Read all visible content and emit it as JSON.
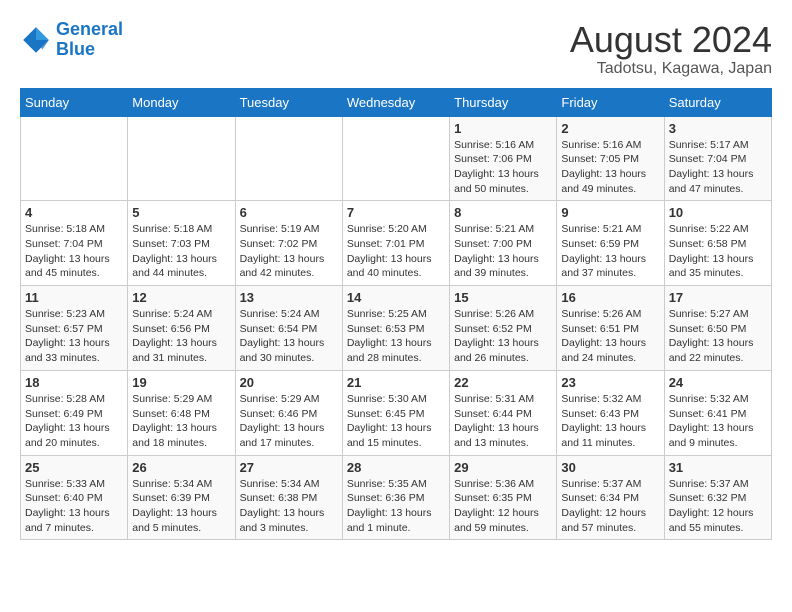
{
  "header": {
    "logo_line1": "General",
    "logo_line2": "Blue",
    "month_year": "August 2024",
    "location": "Tadotsu, Kagawa, Japan"
  },
  "weekdays": [
    "Sunday",
    "Monday",
    "Tuesday",
    "Wednesday",
    "Thursday",
    "Friday",
    "Saturday"
  ],
  "weeks": [
    [
      {
        "day": "",
        "info": ""
      },
      {
        "day": "",
        "info": ""
      },
      {
        "day": "",
        "info": ""
      },
      {
        "day": "",
        "info": ""
      },
      {
        "day": "1",
        "info": "Sunrise: 5:16 AM\nSunset: 7:06 PM\nDaylight: 13 hours\nand 50 minutes."
      },
      {
        "day": "2",
        "info": "Sunrise: 5:16 AM\nSunset: 7:05 PM\nDaylight: 13 hours\nand 49 minutes."
      },
      {
        "day": "3",
        "info": "Sunrise: 5:17 AM\nSunset: 7:04 PM\nDaylight: 13 hours\nand 47 minutes."
      }
    ],
    [
      {
        "day": "4",
        "info": "Sunrise: 5:18 AM\nSunset: 7:04 PM\nDaylight: 13 hours\nand 45 minutes."
      },
      {
        "day": "5",
        "info": "Sunrise: 5:18 AM\nSunset: 7:03 PM\nDaylight: 13 hours\nand 44 minutes."
      },
      {
        "day": "6",
        "info": "Sunrise: 5:19 AM\nSunset: 7:02 PM\nDaylight: 13 hours\nand 42 minutes."
      },
      {
        "day": "7",
        "info": "Sunrise: 5:20 AM\nSunset: 7:01 PM\nDaylight: 13 hours\nand 40 minutes."
      },
      {
        "day": "8",
        "info": "Sunrise: 5:21 AM\nSunset: 7:00 PM\nDaylight: 13 hours\nand 39 minutes."
      },
      {
        "day": "9",
        "info": "Sunrise: 5:21 AM\nSunset: 6:59 PM\nDaylight: 13 hours\nand 37 minutes."
      },
      {
        "day": "10",
        "info": "Sunrise: 5:22 AM\nSunset: 6:58 PM\nDaylight: 13 hours\nand 35 minutes."
      }
    ],
    [
      {
        "day": "11",
        "info": "Sunrise: 5:23 AM\nSunset: 6:57 PM\nDaylight: 13 hours\nand 33 minutes."
      },
      {
        "day": "12",
        "info": "Sunrise: 5:24 AM\nSunset: 6:56 PM\nDaylight: 13 hours\nand 31 minutes."
      },
      {
        "day": "13",
        "info": "Sunrise: 5:24 AM\nSunset: 6:54 PM\nDaylight: 13 hours\nand 30 minutes."
      },
      {
        "day": "14",
        "info": "Sunrise: 5:25 AM\nSunset: 6:53 PM\nDaylight: 13 hours\nand 28 minutes."
      },
      {
        "day": "15",
        "info": "Sunrise: 5:26 AM\nSunset: 6:52 PM\nDaylight: 13 hours\nand 26 minutes."
      },
      {
        "day": "16",
        "info": "Sunrise: 5:26 AM\nSunset: 6:51 PM\nDaylight: 13 hours\nand 24 minutes."
      },
      {
        "day": "17",
        "info": "Sunrise: 5:27 AM\nSunset: 6:50 PM\nDaylight: 13 hours\nand 22 minutes."
      }
    ],
    [
      {
        "day": "18",
        "info": "Sunrise: 5:28 AM\nSunset: 6:49 PM\nDaylight: 13 hours\nand 20 minutes."
      },
      {
        "day": "19",
        "info": "Sunrise: 5:29 AM\nSunset: 6:48 PM\nDaylight: 13 hours\nand 18 minutes."
      },
      {
        "day": "20",
        "info": "Sunrise: 5:29 AM\nSunset: 6:46 PM\nDaylight: 13 hours\nand 17 minutes."
      },
      {
        "day": "21",
        "info": "Sunrise: 5:30 AM\nSunset: 6:45 PM\nDaylight: 13 hours\nand 15 minutes."
      },
      {
        "day": "22",
        "info": "Sunrise: 5:31 AM\nSunset: 6:44 PM\nDaylight: 13 hours\nand 13 minutes."
      },
      {
        "day": "23",
        "info": "Sunrise: 5:32 AM\nSunset: 6:43 PM\nDaylight: 13 hours\nand 11 minutes."
      },
      {
        "day": "24",
        "info": "Sunrise: 5:32 AM\nSunset: 6:41 PM\nDaylight: 13 hours\nand 9 minutes."
      }
    ],
    [
      {
        "day": "25",
        "info": "Sunrise: 5:33 AM\nSunset: 6:40 PM\nDaylight: 13 hours\nand 7 minutes."
      },
      {
        "day": "26",
        "info": "Sunrise: 5:34 AM\nSunset: 6:39 PM\nDaylight: 13 hours\nand 5 minutes."
      },
      {
        "day": "27",
        "info": "Sunrise: 5:34 AM\nSunset: 6:38 PM\nDaylight: 13 hours\nand 3 minutes."
      },
      {
        "day": "28",
        "info": "Sunrise: 5:35 AM\nSunset: 6:36 PM\nDaylight: 13 hours\nand 1 minute."
      },
      {
        "day": "29",
        "info": "Sunrise: 5:36 AM\nSunset: 6:35 PM\nDaylight: 12 hours\nand 59 minutes."
      },
      {
        "day": "30",
        "info": "Sunrise: 5:37 AM\nSunset: 6:34 PM\nDaylight: 12 hours\nand 57 minutes."
      },
      {
        "day": "31",
        "info": "Sunrise: 5:37 AM\nSunset: 6:32 PM\nDaylight: 12 hours\nand 55 minutes."
      }
    ]
  ]
}
